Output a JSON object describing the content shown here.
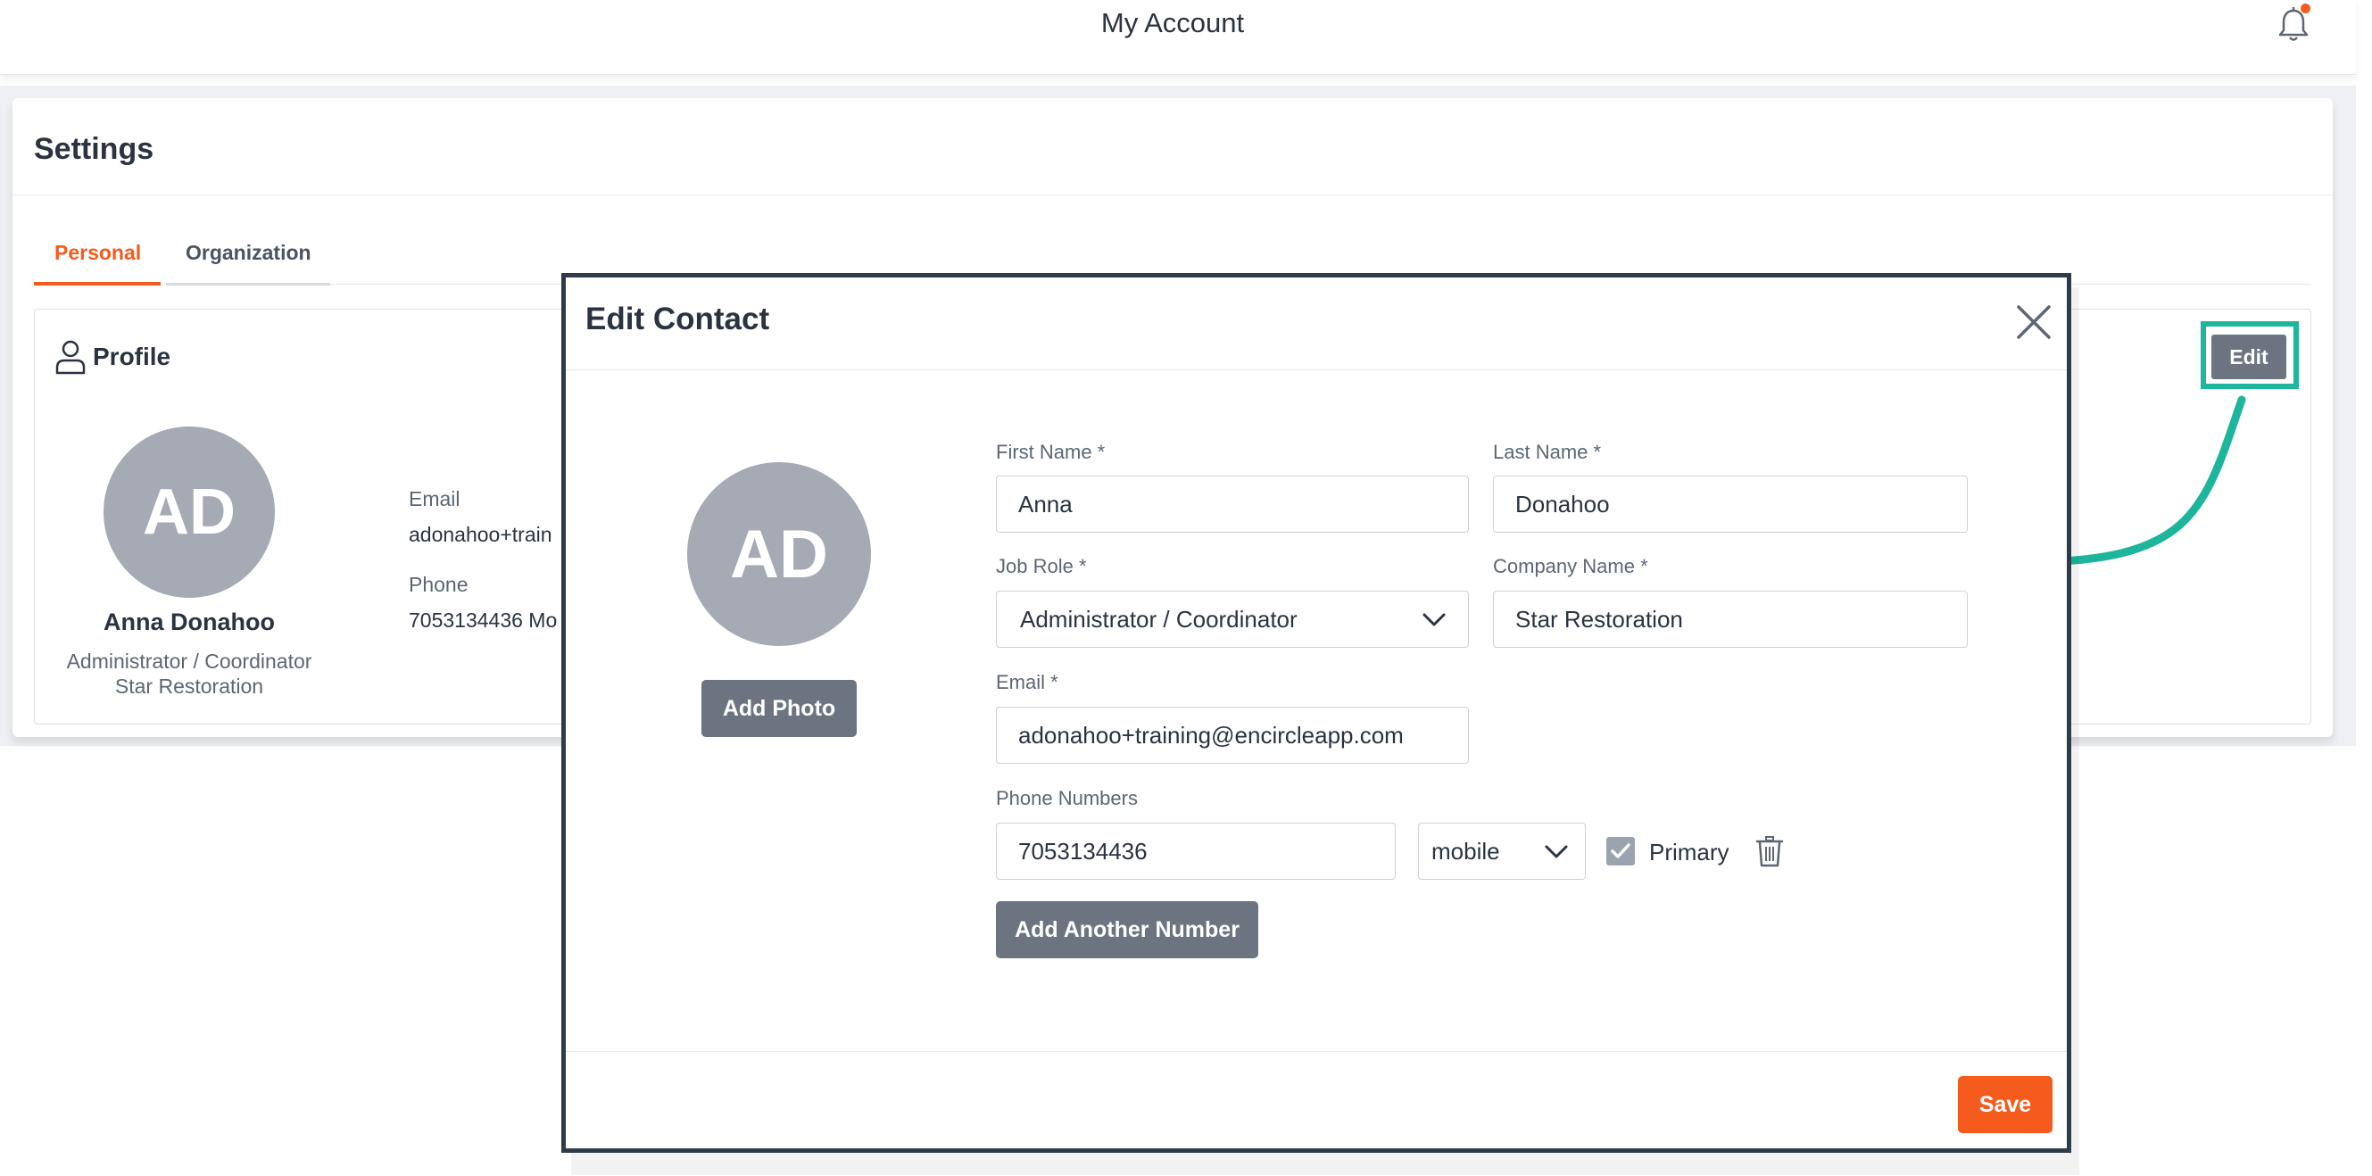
{
  "header": {
    "title": "My Account",
    "notification_icon": "bell-icon",
    "notification_dot_color": "#f45b1c"
  },
  "settings": {
    "title": "Settings",
    "tabs": [
      {
        "label": "Personal",
        "active": true
      },
      {
        "label": "Organization",
        "active": false
      }
    ],
    "profile": {
      "heading": "Profile",
      "icon": "user-icon",
      "initials": "AD",
      "name": "Anna Donahoo",
      "role": "Administrator / Coordinator",
      "company": "Star Restoration",
      "email_label": "Email",
      "email_value": "adonahoo+train",
      "phone_label": "Phone",
      "phone_value": "7053134436 Mo",
      "edit_label": "Edit"
    }
  },
  "annotation": {
    "highlight_color": "#1db59b",
    "arrow_color": "#1db59b"
  },
  "modal": {
    "title": "Edit Contact",
    "initials": "AD",
    "add_photo_label": "Add Photo",
    "fields": {
      "first_name": {
        "label": "First Name *",
        "value": "Anna"
      },
      "last_name": {
        "label": "Last Name *",
        "value": "Donahoo"
      },
      "job_role": {
        "label": "Job Role *",
        "value": "Administrator / Coordinator"
      },
      "company_name": {
        "label": "Company Name *",
        "value": "Star Restoration"
      },
      "email": {
        "label": "Email *",
        "value": "adonahoo+training@encircleapp.com"
      },
      "phone_numbers": {
        "label": "Phone Numbers",
        "number": "7053134436",
        "type": "mobile",
        "primary_label": "Primary",
        "primary_checked": true
      }
    },
    "add_number_label": "Add Another Number",
    "save_label": "Save"
  },
  "colors": {
    "accent": "#f45b1c",
    "button_grey": "#6b7480",
    "avatar_grey": "#a5aab4"
  }
}
